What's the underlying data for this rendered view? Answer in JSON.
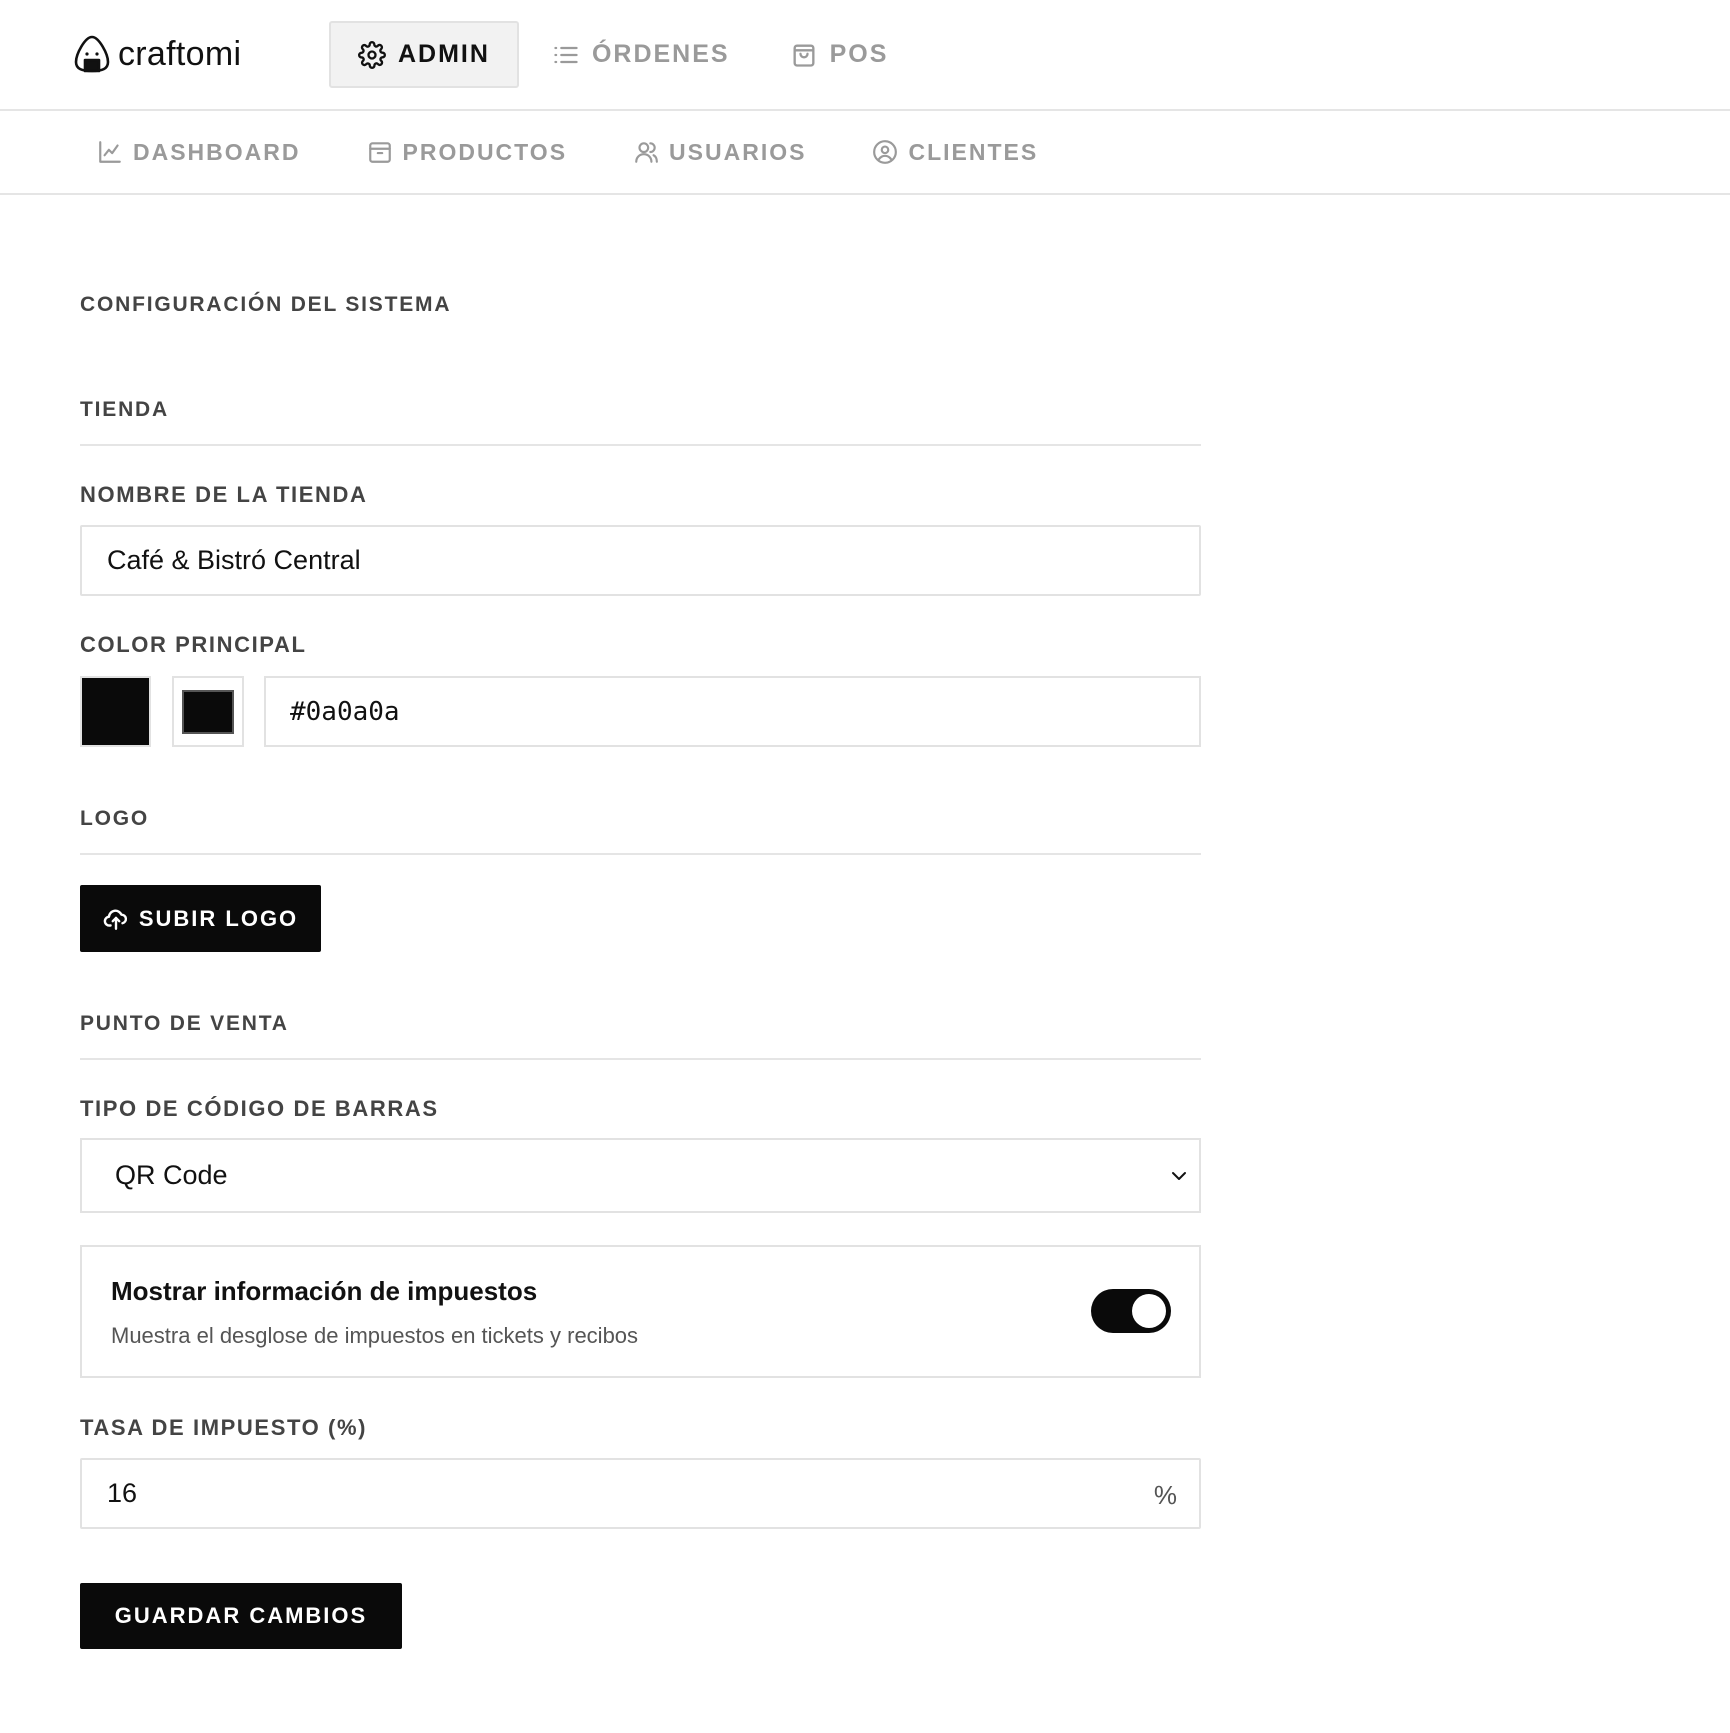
{
  "brand": {
    "name": "craftomi"
  },
  "topnav": [
    {
      "label": "ADMIN",
      "icon": "gear-icon",
      "active": true
    },
    {
      "label": "ÓRDENES",
      "icon": "list-icon",
      "active": false
    },
    {
      "label": "POS",
      "icon": "shopping-bag-icon",
      "active": false
    }
  ],
  "subnav": [
    {
      "label": "DASHBOARD",
      "icon": "chart-line-icon"
    },
    {
      "label": "PRODUCTOS",
      "icon": "box-icon"
    },
    {
      "label": "USUARIOS",
      "icon": "users-icon"
    },
    {
      "label": "CLIENTES",
      "icon": "user-circle-icon"
    }
  ],
  "page": {
    "title": "CONFIGURACIÓN DEL SISTEMA",
    "store_section": {
      "title": "TIENDA",
      "name_label": "NOMBRE DE LA TIENDA",
      "name_value": "Café & Bistró Central",
      "color_label": "COLOR PRINCIPAL",
      "color_value": "#0a0a0a"
    },
    "logo_section": {
      "title": "LOGO",
      "upload_label": "SUBIR LOGO"
    },
    "pos_section": {
      "title": "PUNTO DE VENTA",
      "barcode_label": "TIPO DE CÓDIGO DE BARRAS",
      "barcode_value": "QR Code",
      "tax_toggle": {
        "title": "Mostrar información de impuestos",
        "description": "Muestra el desglose de impuestos en tickets y recibos",
        "enabled": true
      },
      "tax_rate_label": "TASA DE IMPUESTO (%)",
      "tax_rate_value": "16",
      "tax_rate_suffix": "%"
    },
    "save_label": "GUARDAR CAMBIOS"
  },
  "colors": {
    "accent": "#0a0a0a",
    "border": "#e2e2e2",
    "muted": "#9a9a9a"
  }
}
